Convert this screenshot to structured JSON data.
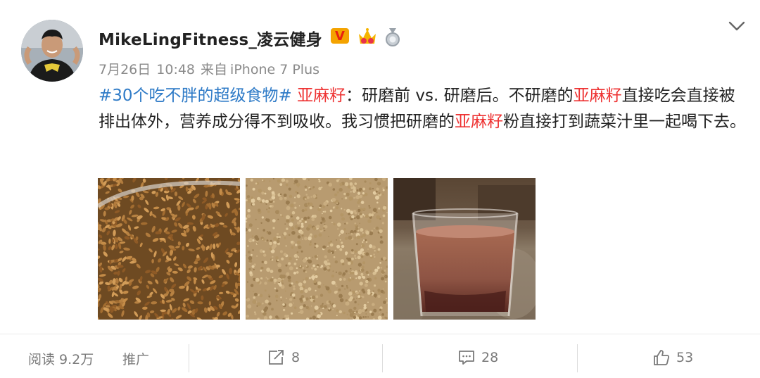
{
  "post": {
    "author": "MikeLingFitness_凌云健身",
    "verified_badge": "V",
    "date": "7月26日",
    "time": "10:48",
    "source_prefix": "来自",
    "source_device": "iPhone 7 Plus",
    "segments": [
      {
        "text": "#30个吃不胖的超级食物#",
        "kind": "tag"
      },
      {
        "text": " ",
        "kind": "text"
      },
      {
        "text": "亚麻籽",
        "kind": "kw"
      },
      {
        "text": "：研磨前 vs. 研磨后。不研磨的",
        "kind": "text"
      },
      {
        "text": "亚麻籽",
        "kind": "kw"
      },
      {
        "text": "直接吃会直接被排出体外，营养成分得不到吸收。我习惯把研磨的",
        "kind": "text"
      },
      {
        "text": "亚麻籽",
        "kind": "kw"
      },
      {
        "text": "粉直接打到蔬菜汁里一起喝下去。",
        "kind": "text"
      }
    ]
  },
  "footer": {
    "reads_label": "阅读",
    "reads_value": "9.2万",
    "promote": "推广",
    "reposts": "8",
    "comments": "28",
    "likes": "53"
  },
  "colors": {
    "topic": "#2f7bc7",
    "keyword": "#ee3333",
    "meta": "#8a8a8a",
    "badge_bg": "#f4a300",
    "badge_fg": "#e8210f"
  },
  "icons": [
    "chevron-down-icon",
    "verified-v-icon",
    "crown-badge-icon",
    "medal-badge-icon",
    "repost-icon",
    "comment-icon",
    "like-icon"
  ]
}
